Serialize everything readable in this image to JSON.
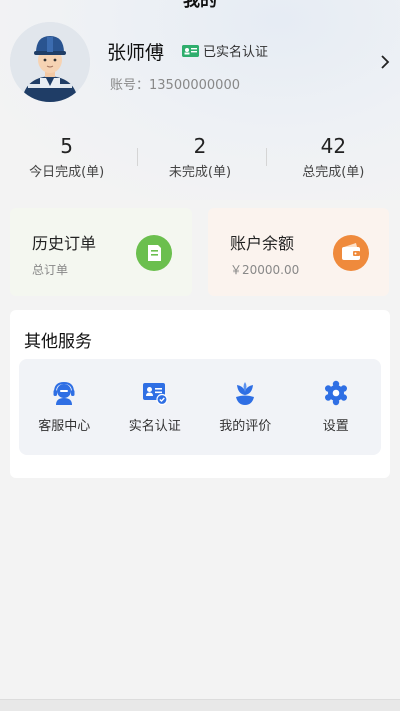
{
  "header": {
    "title": "我的"
  },
  "profile": {
    "name": "张师傅",
    "verify_label": "已实名认证",
    "account_label": "账号：",
    "account_value": "13500000000"
  },
  "stats": [
    {
      "value": "5",
      "label": "今日完成(单)"
    },
    {
      "value": "2",
      "label": "未完成(单)"
    },
    {
      "value": "42",
      "label": "总完成(单)"
    }
  ],
  "cards": {
    "history": {
      "title": "历史订单",
      "subtitle": "总订单",
      "icon": "document-icon",
      "color": "#6bbf4e"
    },
    "balance": {
      "title": "账户余额",
      "subtitle": "￥20000.00",
      "icon": "wallet-icon",
      "color": "#ef8a3c"
    }
  },
  "services": {
    "title": "其他服务",
    "items": [
      {
        "label": "客服中心",
        "icon": "headset-icon"
      },
      {
        "label": "实名认证",
        "icon": "id-card-icon"
      },
      {
        "label": "我的评价",
        "icon": "flower-icon"
      },
      {
        "label": "设置",
        "icon": "gear-icon"
      }
    ],
    "accent": "#2f6fe4"
  }
}
